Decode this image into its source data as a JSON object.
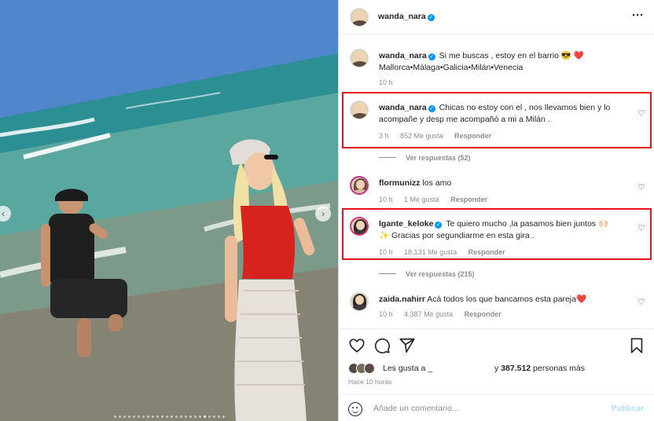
{
  "post_author": {
    "username": "wanda_nara",
    "verified": true
  },
  "header": {
    "more_icon": "more-options-icon"
  },
  "caption": {
    "username": "wanda_nara",
    "text": "Si me buscas , estoy en el barrio 😎 ❤️",
    "text_line2": "Mallorca•Málaga•Galicia•Milán•Venecia",
    "time": "10 h"
  },
  "comments": [
    {
      "username": "wanda_nara",
      "verified": true,
      "text": "Chicas no estoy con el , nos llevamos bien y lo acompañe y desp me acompañó a mi a Milán .",
      "time": "3 h",
      "likes": "852 Me gusta",
      "reply": "Responder",
      "highlighted": true,
      "view_replies": "Ver respuestas (52)"
    },
    {
      "username": "flormunizz",
      "verified": false,
      "text": "los amo",
      "time": "10 h",
      "likes": "1 Me gusta",
      "reply": "Responder",
      "highlighted": false
    },
    {
      "username": "lgante_keloke",
      "verified": true,
      "text": "Te quiero mucho ,la pasamos bien juntos 🙌🏻",
      "text_line2": "✨ Gracias por segundiarme en esta gira .",
      "time": "10 h",
      "likes": "18.131 Me gusta",
      "reply": "Responder",
      "highlighted": true,
      "view_replies": "Ver respuestas (215)"
    },
    {
      "username": "zaida.nahirr",
      "verified": false,
      "text": "Acá todos los que bancamos esta pareja❤️",
      "time": "10 h",
      "likes": "4.387 Me gusta",
      "reply": "Responder",
      "highlighted": false
    }
  ],
  "actions": {
    "like_icon": "heart-icon",
    "comment_icon": "comment-icon",
    "share_icon": "share-icon",
    "save_icon": "bookmark-icon"
  },
  "likes_summary": {
    "prefix": "Les gusta a _",
    "suffix_pre": "y ",
    "count": "387.512",
    "suffix_post": " personas más"
  },
  "time_ago": "Hace 10 horas",
  "add_comment": {
    "placeholder": "Añade un comentario...",
    "publish_label": "Publicar"
  },
  "colors": {
    "highlight_border": "#e3161b",
    "verified": "#0095f6",
    "publish": "#b2dffc"
  },
  "carousel": {
    "total_dots": 24,
    "active_index": 19
  }
}
